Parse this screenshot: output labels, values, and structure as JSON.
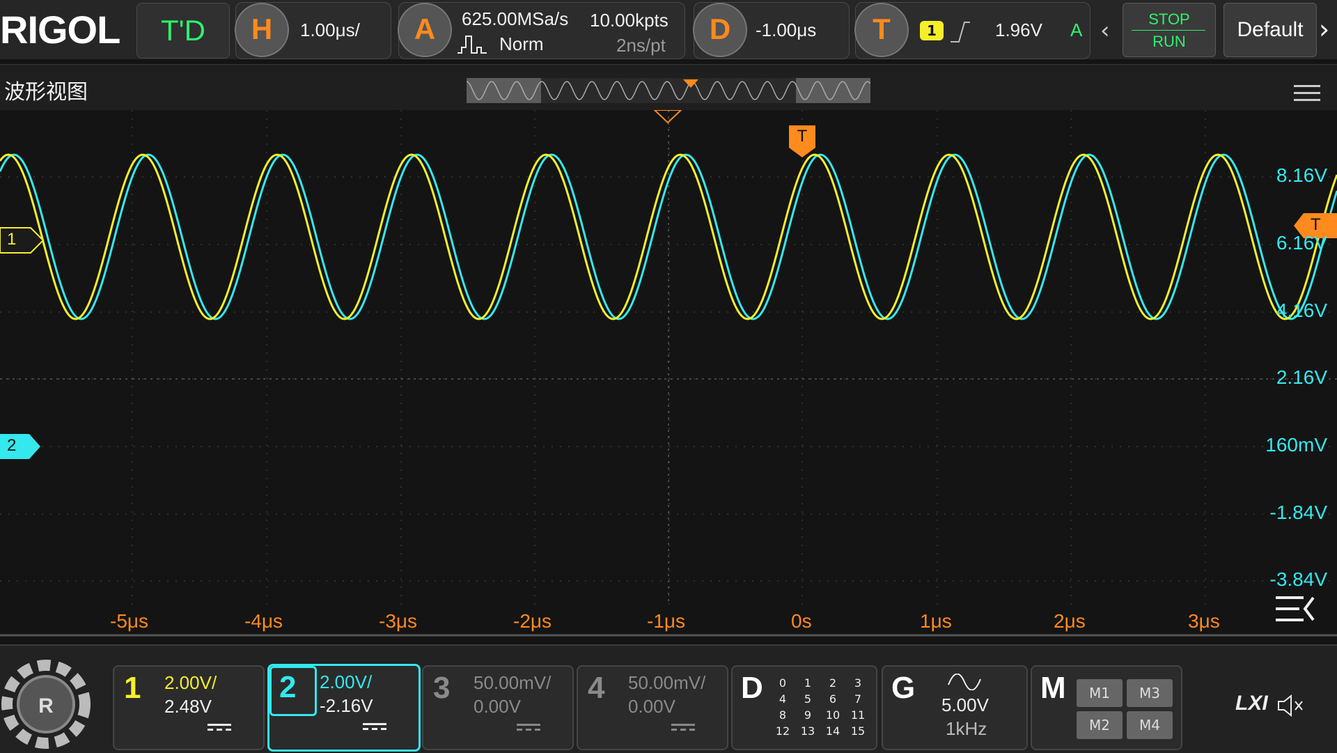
{
  "brand": "RIGOL",
  "mode_label": "T'D",
  "horizontal": {
    "letter": "H",
    "scale": "1.00μs/"
  },
  "acquire": {
    "letter": "A",
    "sample_rate": "625.00MSa/s",
    "mode": "Norm",
    "points": "10.00kpts",
    "time_per_pt": "2ns/pt"
  },
  "delay": {
    "letter": "D",
    "value": "-1.00μs"
  },
  "trigger": {
    "letter": "T",
    "source_channel": "1",
    "level": "1.96V",
    "mode": "A"
  },
  "run_state": {
    "stop_label": "STOP",
    "run_label": "RUN"
  },
  "default_label": "Default",
  "window_title": "波形视图",
  "voltage_labels": [
    "8.16V",
    "6.16V",
    "4.16V",
    "2.16V",
    "160mV",
    "-1.84V",
    "-3.84V"
  ],
  "time_labels": [
    "-5μs",
    "-4μs",
    "-3μs",
    "-2μs",
    "-1μs",
    "0s",
    "1μs",
    "2μs",
    "3μs"
  ],
  "markers": {
    "ch1": "1",
    "ch2": "2",
    "trigger_pos": "T",
    "trigger_level": "T"
  },
  "channels": [
    {
      "num": "1",
      "scale": "2.00V/",
      "offset": "2.48V",
      "color": "#f5ef2a",
      "active": false
    },
    {
      "num": "2",
      "scale": "2.00V/",
      "offset": "-2.16V",
      "color": "#34e8ee",
      "active": true
    },
    {
      "num": "3",
      "scale": "50.00mV/",
      "offset": "0.00V",
      "color": "#8a8a8a",
      "active": false
    },
    {
      "num": "4",
      "scale": "50.00mV/",
      "offset": "0.00V",
      "color": "#8a8a8a",
      "active": false
    }
  ],
  "digital": {
    "letter": "D",
    "bits": [
      "0",
      "1",
      "2",
      "3",
      "4",
      "5",
      "6",
      "7",
      "8",
      "9",
      "10",
      "11",
      "12",
      "13",
      "14",
      "15"
    ]
  },
  "generator": {
    "letter": "G",
    "amplitude": "5.00V",
    "frequency": "1kHz"
  },
  "math": {
    "letter": "M",
    "buttons": [
      "M1",
      "M3",
      "M2",
      "M4"
    ]
  },
  "lxi_label": "LXI",
  "colors": {
    "ch1": "#f5ef2a",
    "ch2": "#34e8ee",
    "trigger": "#ff8a1d",
    "run": "#2ef26e"
  }
}
